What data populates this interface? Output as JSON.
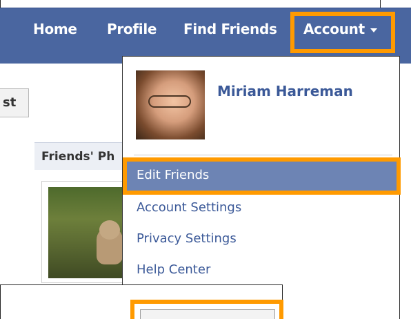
{
  "nav": {
    "home": "Home",
    "profile": "Profile",
    "find_friends": "Find Friends",
    "account": "Account"
  },
  "page": {
    "tab_fragment": "st",
    "section_header": "Friends' Ph"
  },
  "dropdown": {
    "user_name": "Miriam Harreman",
    "items": [
      "Edit Friends",
      "Account Settings",
      "Privacy Settings",
      "Help Center"
    ]
  },
  "colors": {
    "navbar": "#4a66a0",
    "highlight": "#ff9a00",
    "link": "#3b5998",
    "selected_row": "#6d84b4"
  },
  "icons": {
    "account_caret": "chevron-down-icon"
  }
}
